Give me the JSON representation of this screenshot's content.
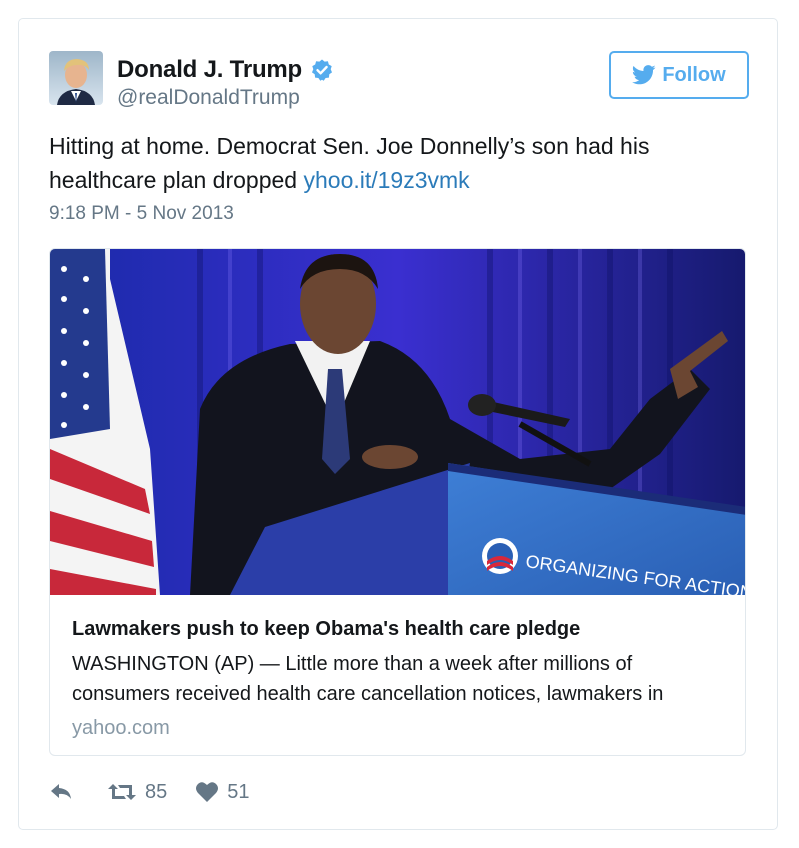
{
  "author": {
    "display_name": "Donald J. Trump",
    "handle": "@realDonaldTrump",
    "verified": true,
    "avatar_icon": "profile-photo"
  },
  "follow": {
    "label": "Follow",
    "icon": "twitter-bird-icon",
    "color": "#55acee"
  },
  "tweet": {
    "text": "Hitting at home. Democrat Sen. Joe Donnelly’s son had his healthcare plan dropped ",
    "link_text": "yhoo.it/19z3vmk",
    "link_color": "#2b7bb9",
    "timestamp": "9:18 PM - 5 Nov 2013"
  },
  "card": {
    "image_text": "ORGANIZING FOR ACTION",
    "title": "Lawmakers push to keep Obama's health care pledge",
    "description": "WASHINGTON (AP) — Little more than a week after millions of consumers received health care cancellation notices, lawmakers in",
    "domain": "yahoo.com"
  },
  "actions": {
    "reply_icon": "reply-icon",
    "retweet_icon": "retweet-icon",
    "retweet_count": "85",
    "like_icon": "heart-icon",
    "like_count": "51"
  }
}
